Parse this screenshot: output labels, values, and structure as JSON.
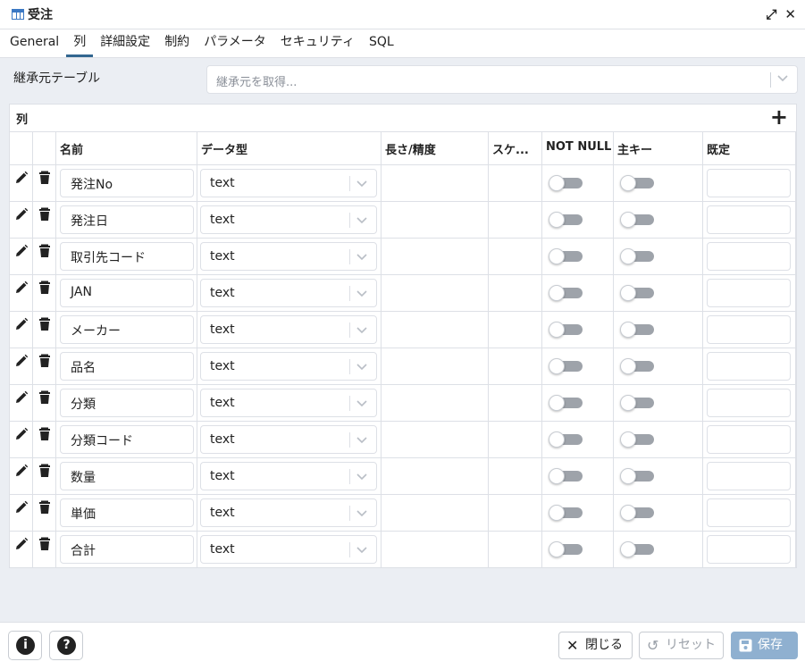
{
  "window": {
    "title": "受注",
    "expand_glyph": "⤢",
    "close_glyph": "✕"
  },
  "tabs": [
    "General",
    "列",
    "詳細設定",
    "制約",
    "パラメータ",
    "セキュリティ",
    "SQL"
  ],
  "active_tab": 1,
  "inherit": {
    "label": "継承元テーブル",
    "placeholder": "継承元を取得..."
  },
  "columns_panel": {
    "label": "列",
    "add_glyph": "+",
    "headers": [
      "",
      "",
      "名前",
      "データ型",
      "長さ/精度",
      "スケ...",
      "NOT NULL",
      "主キー",
      "既定"
    ],
    "rows": [
      {
        "name": "発注No",
        "type": "text",
        "not_null": false,
        "primary_key": false,
        "default": ""
      },
      {
        "name": "発注日",
        "type": "text",
        "not_null": false,
        "primary_key": false,
        "default": ""
      },
      {
        "name": "取引先コード",
        "type": "text",
        "not_null": false,
        "primary_key": false,
        "default": ""
      },
      {
        "name": "JAN",
        "type": "text",
        "not_null": false,
        "primary_key": false,
        "default": ""
      },
      {
        "name": "メーカー",
        "type": "text",
        "not_null": false,
        "primary_key": false,
        "default": ""
      },
      {
        "name": "品名",
        "type": "text",
        "not_null": false,
        "primary_key": false,
        "default": ""
      },
      {
        "name": "分類",
        "type": "text",
        "not_null": false,
        "primary_key": false,
        "default": ""
      },
      {
        "name": "分類コード",
        "type": "text",
        "not_null": false,
        "primary_key": false,
        "default": ""
      },
      {
        "name": "数量",
        "type": "text",
        "not_null": false,
        "primary_key": false,
        "default": ""
      },
      {
        "name": "単価",
        "type": "text",
        "not_null": false,
        "primary_key": false,
        "default": ""
      },
      {
        "name": "合計",
        "type": "text",
        "not_null": false,
        "primary_key": false,
        "default": ""
      }
    ]
  },
  "footer": {
    "info_glyph": "i",
    "help_glyph": "?",
    "close_label": "閉じる",
    "close_glyph": "✕",
    "reset_label": "リセット",
    "reset_glyph": "↺",
    "save_label": "保存"
  },
  "colors": {
    "accent": "#326690",
    "content_bg": "#ebeef3",
    "border": "#dde0e6",
    "toggle_off": "#9ea3aa",
    "save_button": "#8fb0d0"
  }
}
